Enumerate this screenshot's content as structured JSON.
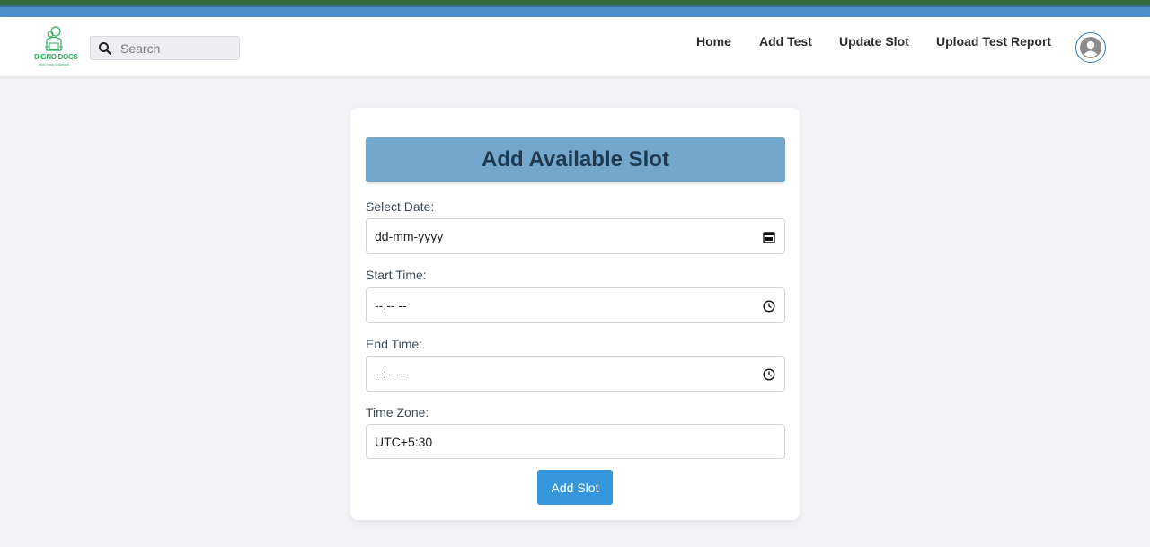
{
  "brand": {
    "name": "DIGNO DOCS",
    "tagline": "click book diagnose",
    "color": "#2fae5e"
  },
  "search": {
    "placeholder": "Search",
    "icon": "search-icon"
  },
  "nav": {
    "items": [
      {
        "label": "Home"
      },
      {
        "label": "Add Test"
      },
      {
        "label": "Update Slot"
      },
      {
        "label": "Upload Test Report"
      }
    ],
    "profile_icon": "user-circle-icon"
  },
  "form": {
    "title": "Add Available Slot",
    "date": {
      "label": "Select Date:",
      "value": "dd-mm-yyyy",
      "icon": "calendar-icon"
    },
    "start_time": {
      "label": "Start Time:",
      "value": "--:-- --",
      "icon": "clock-icon"
    },
    "end_time": {
      "label": "End Time:",
      "value": "--:-- --",
      "icon": "clock-icon"
    },
    "time_zone": {
      "label": "Time Zone:",
      "value": "UTC+5:30"
    },
    "submit_label": "Add Slot"
  },
  "colors": {
    "accent": "#3596dc",
    "header": "#73a7cc",
    "top_bar": "#4a8fc9"
  }
}
